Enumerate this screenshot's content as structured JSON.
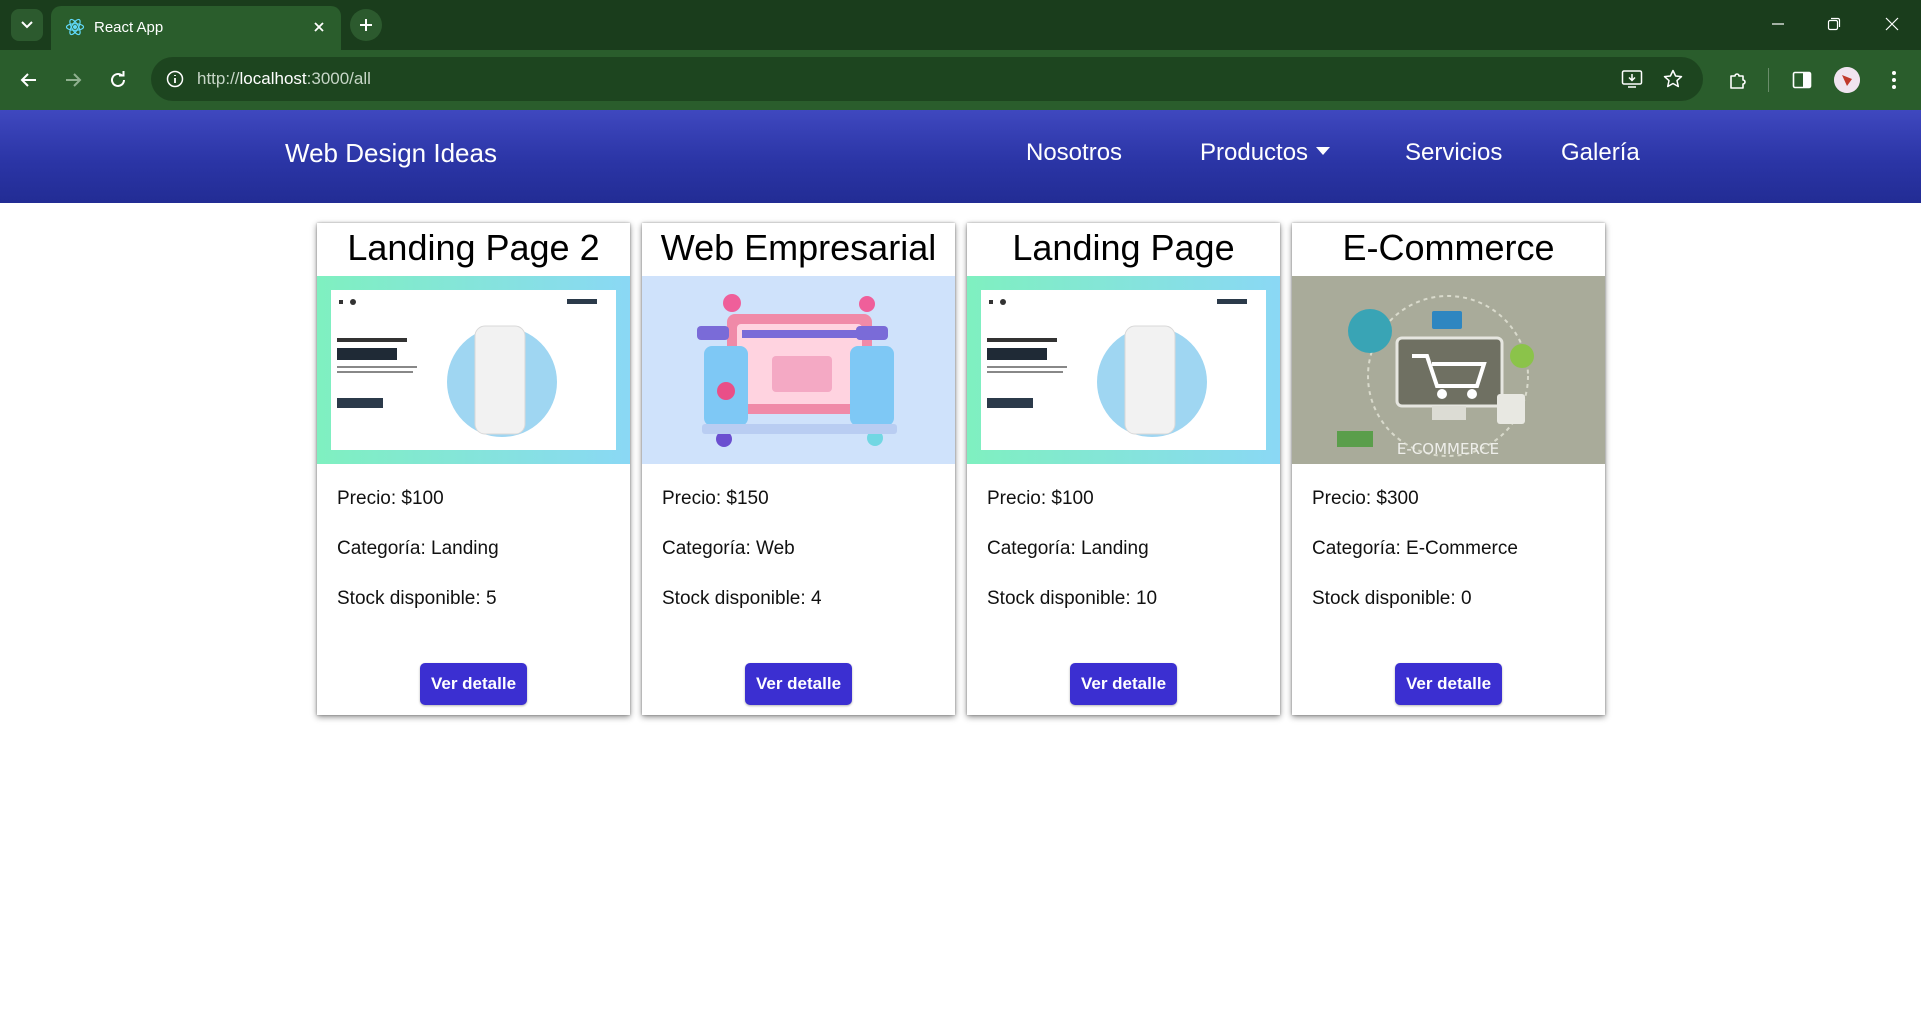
{
  "browser": {
    "tab_title": "React App",
    "url_scheme": "http://",
    "url_host": "localhost",
    "url_path": ":3000/all",
    "icons": {
      "tab_list": "chevron-down-icon",
      "favicon": "react-icon",
      "tab_close": "close-icon",
      "new_tab": "plus-icon",
      "minimize": "minimize-icon",
      "restore": "restore-icon",
      "close_window": "close-icon",
      "back": "arrow-left-icon",
      "forward": "arrow-right-icon",
      "reload": "reload-icon",
      "site_info": "info-icon",
      "install": "install-app-icon",
      "bookmark": "star-icon",
      "extensions": "puzzle-icon",
      "side_panel": "side-panel-icon",
      "menu": "kebab-menu-icon"
    }
  },
  "navbar": {
    "brand": "Web Design Ideas",
    "links": [
      {
        "label": "Nosotros"
      },
      {
        "label": "Productos",
        "dropdown": true
      },
      {
        "label": "Servicios"
      },
      {
        "label": "Galería"
      }
    ],
    "color": "#2b35a6"
  },
  "products": [
    {
      "title": "Landing Page 2",
      "price_label": "Precio:",
      "price": "$100",
      "category_label": "Categoría:",
      "category": "Landing",
      "stock_label": "Stock disponible:",
      "stock": "5",
      "button": "Ver detalle",
      "image": "landing-page-design-illustration"
    },
    {
      "title": "Web Empresarial",
      "price_label": "Precio:",
      "price": "$150",
      "category_label": "Categoría:",
      "category": "Web",
      "stock_label": "Stock disponible:",
      "stock": "4",
      "button": "Ver detalle",
      "image": "web-devices-illustration"
    },
    {
      "title": "Landing Page",
      "price_label": "Precio:",
      "price": "$100",
      "category_label": "Categoría:",
      "category": "Landing",
      "stock_label": "Stock disponible:",
      "stock": "10",
      "button": "Ver detalle",
      "image": "landing-page-design-illustration"
    },
    {
      "title": "E-Commerce",
      "price_label": "Precio:",
      "price": "$300",
      "category_label": "Categoría:",
      "category": "E-Commerce",
      "stock_label": "Stock disponible:",
      "stock": "0",
      "button": "Ver detalle",
      "image": "ecommerce-cart-illustration",
      "image_text": "E-COMMERCE"
    }
  ],
  "colors": {
    "button": "#3b2fd1",
    "browser_frame": "#2a5d2c"
  }
}
